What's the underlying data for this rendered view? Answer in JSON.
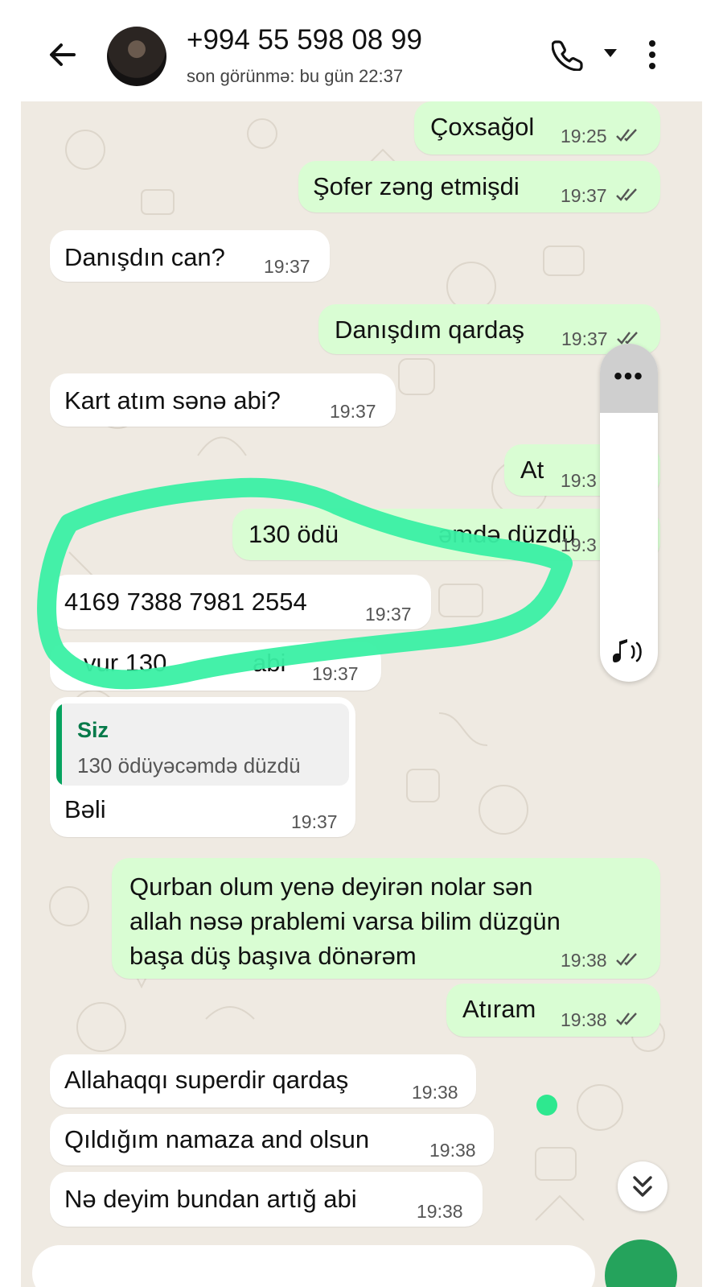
{
  "header": {
    "title": "+994 55 598 08 99",
    "status": "son görünmə: bu gün 22:37"
  },
  "messages": [
    {
      "dir": "out",
      "text": "Çoxsağol",
      "time": "19:25"
    },
    {
      "dir": "out",
      "text": "Şofer zəng etmişdi",
      "time": "19:37"
    },
    {
      "dir": "in",
      "text": "Danışdın can?",
      "time": "19:37"
    },
    {
      "dir": "out",
      "text": "Danışdım qardaş",
      "time": "19:37"
    },
    {
      "dir": "in",
      "text": "Kart atım sənə abi?",
      "time": "19:37"
    },
    {
      "dir": "out",
      "text": "At",
      "time": "19:3"
    },
    {
      "dir": "out",
      "text": "130 ödü",
      "text_tail": "əmdə düzdü",
      "time": "19:3"
    },
    {
      "dir": "in",
      "text": "4169 7388 7981 2554",
      "time": "19:37"
    },
    {
      "dir": "in",
      "text": "vur 130",
      "text_tail": "abi",
      "time": "19:37"
    },
    {
      "dir": "in",
      "quote_author": "Siz",
      "quote_text": "130 ödüyəcəmdə düzdü",
      "text": "Bəli",
      "time": "19:37"
    },
    {
      "dir": "out",
      "lines": [
        "Qurban olum yenə deyirən nolar sən",
        "allah nəsə prablemi varsa bilim düzgün",
        "başa düş başıva dönərəm"
      ],
      "time": "19:38"
    },
    {
      "dir": "out",
      "text": "Atıram",
      "time": "19:38"
    },
    {
      "dir": "in",
      "text": "Allahaqqı superdir qardaş",
      "time": "19:38"
    },
    {
      "dir": "in",
      "text": "Qıldığım namaza and olsun",
      "time": "19:38"
    },
    {
      "dir": "in",
      "text": "Nə deyim bundan artığ abi",
      "time": "19:38"
    }
  ],
  "scroller": {
    "menu": "•••"
  },
  "colors": {
    "outgoing": "#d9fdd3",
    "incoming": "#ffffff",
    "wallpaper": "#efeae2",
    "marker": "#3af0a4",
    "accent": "#25a35c"
  },
  "icons": [
    "back-arrow-icon",
    "phone-icon",
    "caret-down-icon",
    "more-vert-icon",
    "double-check-icon",
    "speaker-icon",
    "double-chevron-down-icon",
    "mic-icon"
  ]
}
